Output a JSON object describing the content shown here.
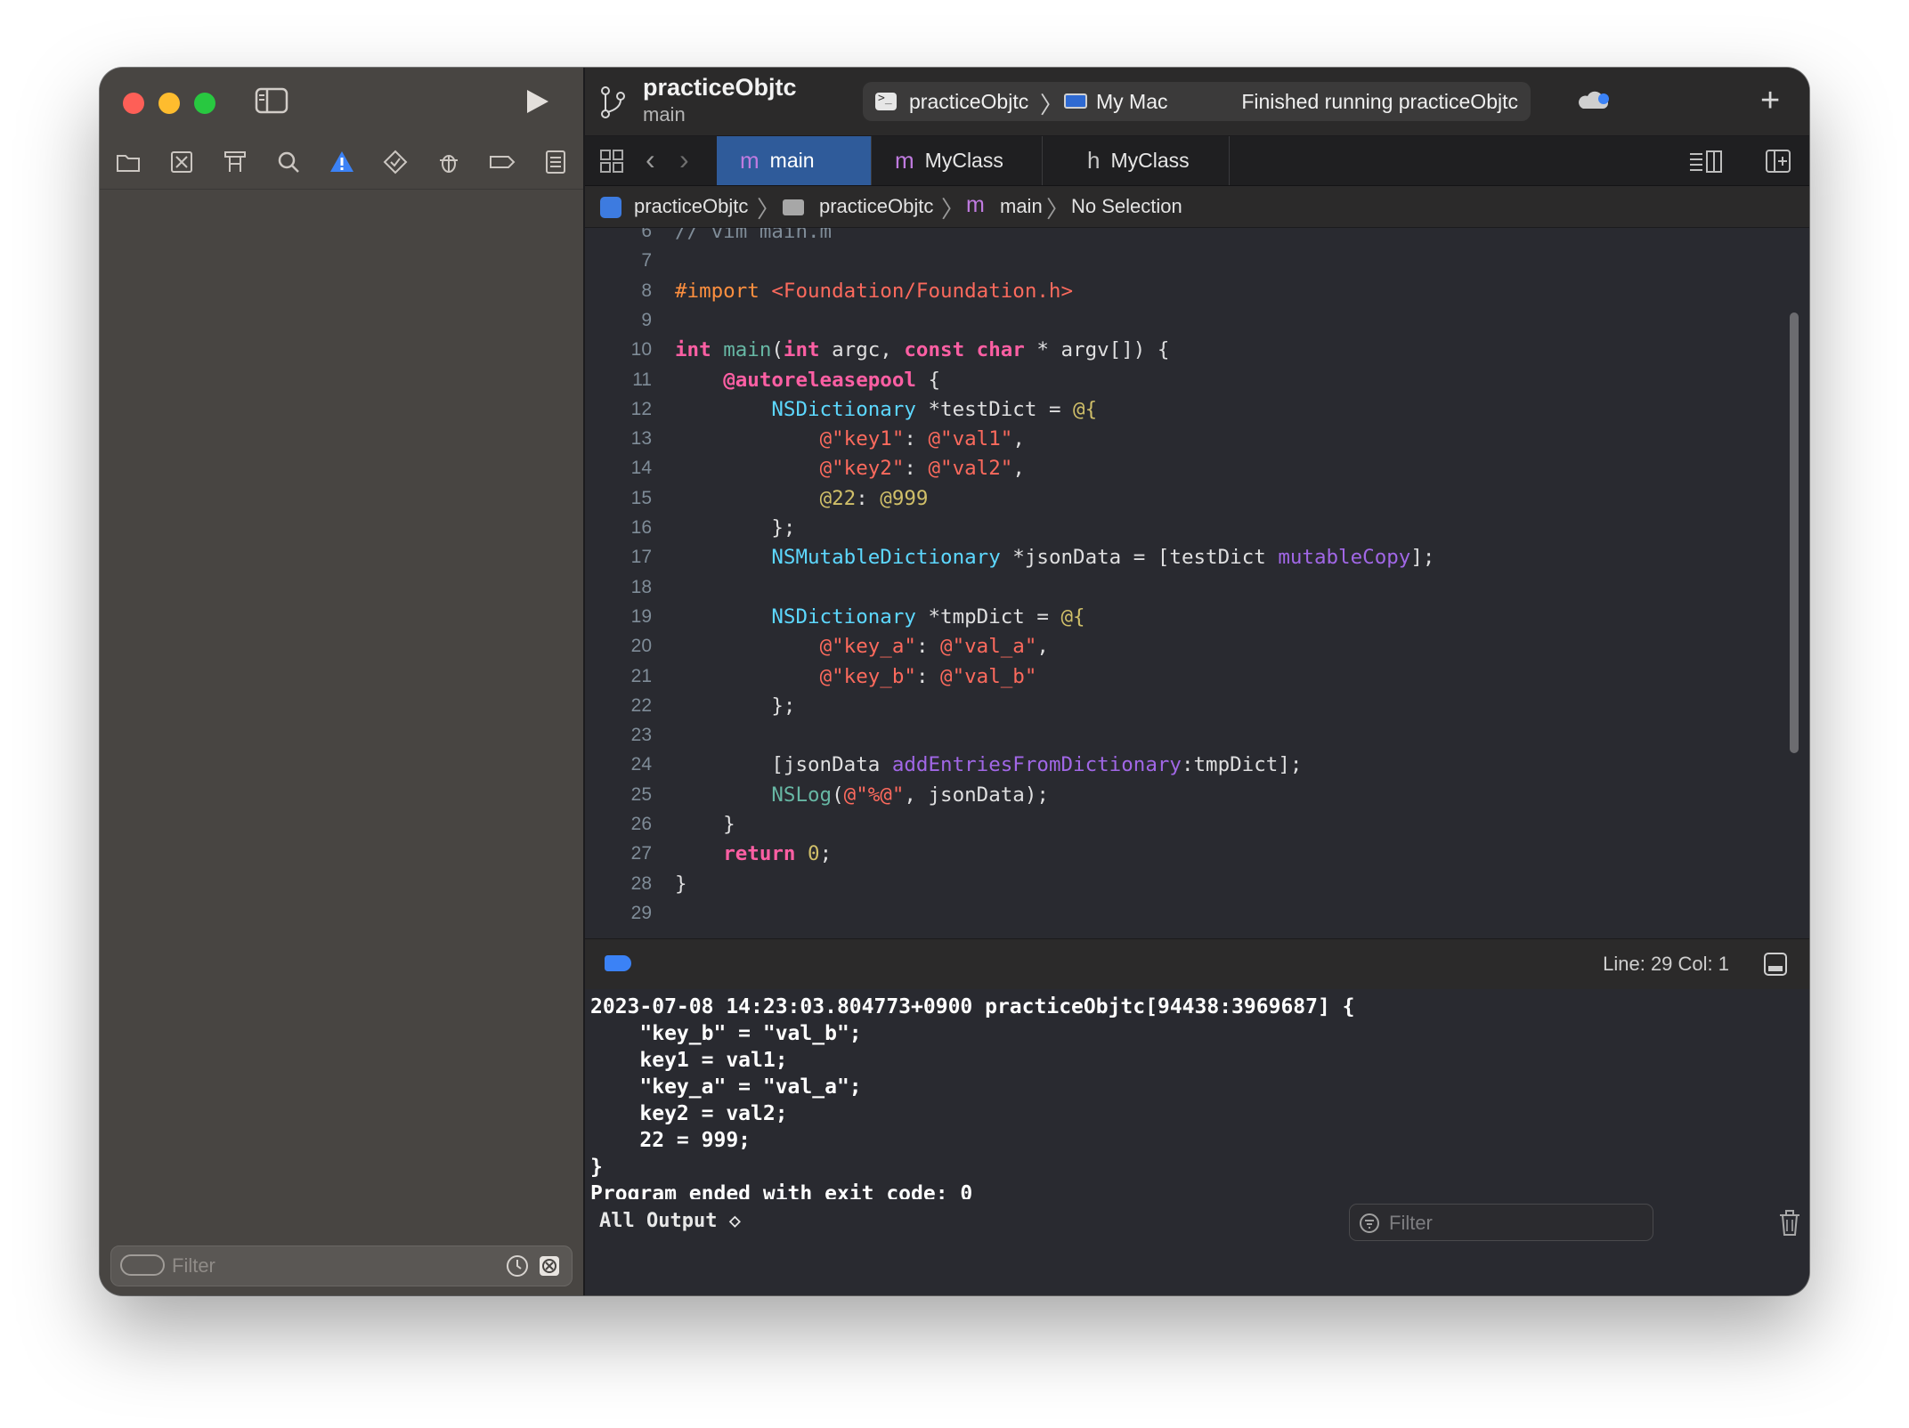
{
  "window": {
    "project_title": "practiceObjtc",
    "branch": "main",
    "scheme": "practiceObjtc",
    "destination": "My Mac",
    "status": "Finished running practiceObjtc"
  },
  "sidebar": {
    "filter_placeholder": "Filter",
    "navigator_icons": [
      "folder-icon",
      "source-control-icon",
      "symbol-icon",
      "find-icon",
      "issue-warning-icon",
      "test-icon",
      "debug-icon",
      "breakpoint-navigator-icon",
      "report-icon"
    ]
  },
  "tabs": [
    {
      "glyph": "m",
      "label": "main",
      "active": true
    },
    {
      "glyph": "m",
      "label": "MyClass",
      "active": false
    },
    {
      "glyph": "h",
      "label": "MyClass",
      "active": false
    }
  ],
  "jumpbar": {
    "project": "practiceObjtc",
    "folder": "practiceObjtc",
    "file_glyph": "m",
    "file": "main",
    "selection": "No Selection"
  },
  "editor": {
    "lines": [
      {
        "n": "6",
        "text": "// vim main.m"
      },
      {
        "n": "7",
        "text": ""
      },
      {
        "n": "8",
        "text": "#import <Foundation/Foundation.h>"
      },
      {
        "n": "9",
        "text": ""
      },
      {
        "n": "10",
        "text": "int main(int argc, const char * argv[]) {"
      },
      {
        "n": "11",
        "text": "    @autoreleasepool {"
      },
      {
        "n": "12",
        "text": "        NSDictionary *testDict = @{"
      },
      {
        "n": "13",
        "text": "            @\"key1\": @\"val1\","
      },
      {
        "n": "14",
        "text": "            @\"key2\": @\"val2\","
      },
      {
        "n": "15",
        "text": "            @22: @999"
      },
      {
        "n": "16",
        "text": "        };"
      },
      {
        "n": "17",
        "text": "        NSMutableDictionary *jsonData = [testDict mutableCopy];"
      },
      {
        "n": "18",
        "text": ""
      },
      {
        "n": "19",
        "text": "        NSDictionary *tmpDict = @{"
      },
      {
        "n": "20",
        "text": "            @\"key_a\": @\"val_a\","
      },
      {
        "n": "21",
        "text": "            @\"key_b\": @\"val_b\""
      },
      {
        "n": "22",
        "text": "        };"
      },
      {
        "n": "23",
        "text": ""
      },
      {
        "n": "24",
        "text": "        [jsonData addEntriesFromDictionary:tmpDict];"
      },
      {
        "n": "25",
        "text": "        NSLog(@\"%@\", jsonData);"
      },
      {
        "n": "26",
        "text": "    }"
      },
      {
        "n": "27",
        "text": "    return 0;"
      },
      {
        "n": "28",
        "text": "}"
      },
      {
        "n": "29",
        "text": ""
      }
    ],
    "cursor_position": "Line: 29  Col: 1"
  },
  "console": {
    "lines": [
      "2023-07-08 14:23:03.804773+0900 practiceObjtc[94438:3969687] {",
      "    \"key_b\" = \"val_b\";",
      "    key1 = val1;",
      "    \"key_a\" = \"val_a\";",
      "    key2 = val2;",
      "    22 = 999;",
      "}",
      "Program ended with exit code: 0"
    ],
    "output_selector": "All Output ◇",
    "filter_placeholder": "Filter"
  },
  "colors": {
    "keyword": "#fc5fa3",
    "preprocessor": "#fd8f3f",
    "string": "#fc6a5d",
    "number": "#d0bf69",
    "type": "#5dd8ff",
    "function": "#67b7a4",
    "method": "#a167e6",
    "active_tab": "#2f5b9a"
  }
}
